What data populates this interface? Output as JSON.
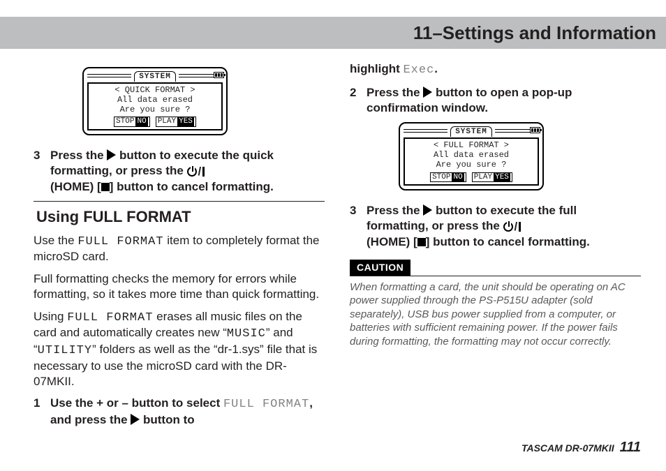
{
  "header": {
    "title": "11–Settings and Information"
  },
  "lcd_quick": {
    "tab": "SYSTEM",
    "line1": "< QUICK FORMAT >",
    "line2": "All data erased",
    "line3": "Are you sure ?",
    "btn_stop": "STOP",
    "btn_no": "NO",
    "btn_play": "PLAY",
    "btn_yes": "YES"
  },
  "lcd_full": {
    "tab": "SYSTEM",
    "line1": "< FULL FORMAT >",
    "line2": "All data erased",
    "line3": "Are you sure ?",
    "btn_stop": "STOP",
    "btn_no": "NO",
    "btn_play": "PLAY",
    "btn_yes": "YES"
  },
  "col1": {
    "step3_a": "Press the ",
    "step3_b": " button to execute the quick formatting, or press the ",
    "step3_home": "(HOME) [",
    "step3_c": "] button to cancel formatting.",
    "section_title": "Using FULL FORMAT",
    "p1_a": "Use the ",
    "p1_code": "FULL FORMAT",
    "p1_b": " item to completely format the microSD card.",
    "p2": "Full formatting checks the memory for errors while formatting, so it takes more time than quick formatting.",
    "p3_a": "Using ",
    "p3_code1": "FULL FORMAT",
    "p3_b": " erases all music files on the card and automatically creates new “",
    "p3_code2": "MUSIC",
    "p3_c": "” and “",
    "p3_code3": "UTILITY",
    "p3_d": "” folders as well as the “dr-1.sys” file that is necessary to use the microSD card with the DR-07MKII.",
    "step1_a": "Use the + or – button to select ",
    "step1_code": "FULL FORMAT",
    "step1_b": ", and press the ",
    "step1_c": " button to"
  },
  "col2": {
    "cont_a": "highlight ",
    "cont_code": "Exec",
    "cont_b": ".",
    "step2_a": "Press the ",
    "step2_b": " button to open a pop-up confirmation window.",
    "step3_a": "Press the ",
    "step3_b": " button to execute the full formatting, or press the ",
    "step3_home": "(HOME) [",
    "step3_c": "] button to cancel formatting.",
    "caution_label": "CAUTION",
    "caution_text": "When formatting a card, the unit should be operating on AC power supplied through the PS-P515U adapter (sold separately), USB bus power supplied from a computer, or batteries with sufficient remaining power. If the power fails during formatting, the formatting may not occur correctly."
  },
  "footer": {
    "brand": "TASCAM DR-07MKII",
    "page": "111"
  }
}
